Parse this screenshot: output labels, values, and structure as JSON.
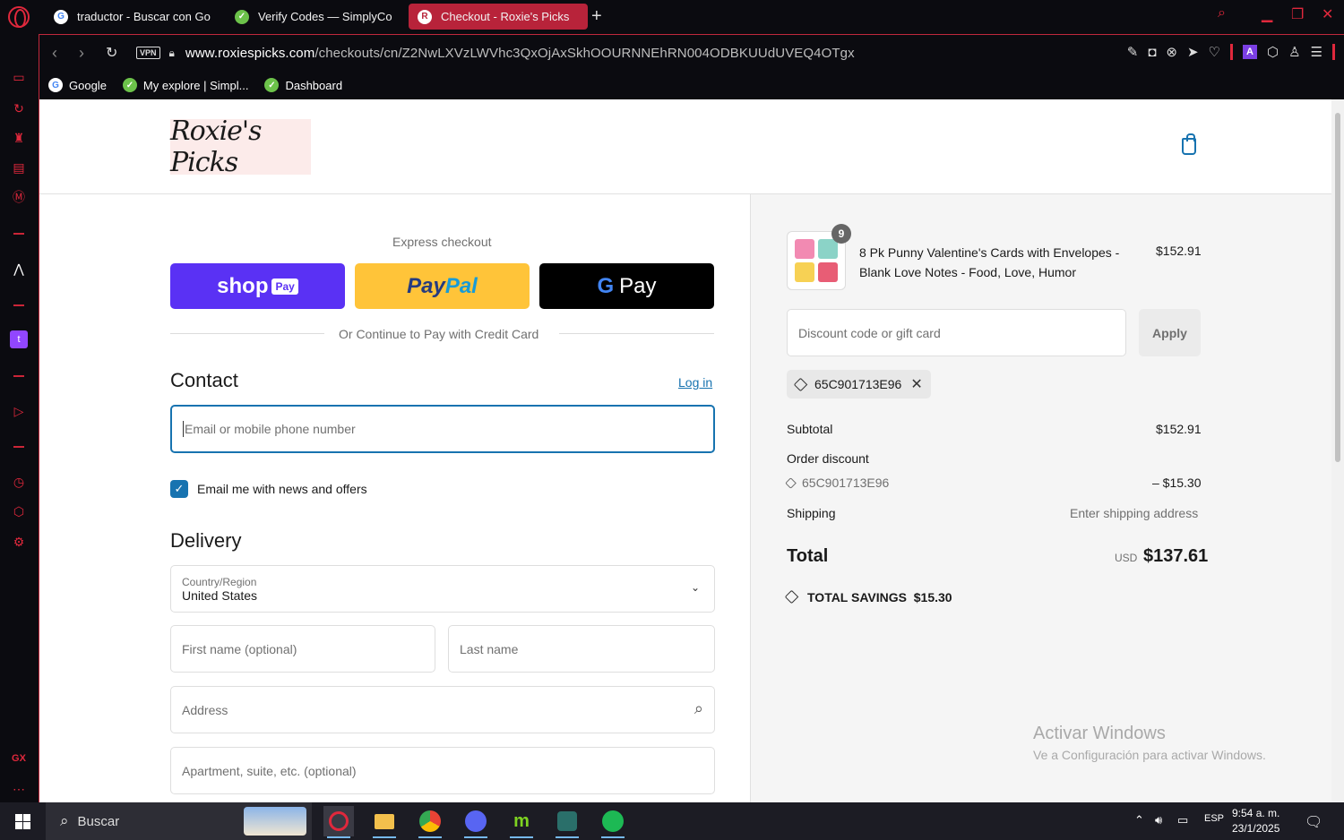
{
  "browser": {
    "tabs": [
      {
        "title": "traductor - Buscar con Go",
        "favicon": "G"
      },
      {
        "title": "Verify Codes — SimplyCo",
        "favicon": "✓"
      },
      {
        "title": "Checkout - Roxie's Picks",
        "favicon": "R"
      }
    ],
    "vpn_label": "VPN",
    "url_domain": "www.roxiespicks.com",
    "url_path": "/checkouts/cn/Z2NwLXVzLWVhc3QxOjAxSkhOOURNNEhRN004ODBKUUdUVEQ4OTgx",
    "bookmarks": [
      {
        "label": "Google",
        "favicon": "G"
      },
      {
        "label": "My explore | Simpl...",
        "favicon": "✓"
      },
      {
        "label": "Dashboard",
        "favicon": "✓"
      }
    ]
  },
  "store": {
    "logo_text": "Roxie's Picks"
  },
  "checkout": {
    "express_label": "Express checkout",
    "shop_pay": {
      "label": "shop",
      "badge": "Pay"
    },
    "paypal": {
      "part1": "Pay",
      "part2": "Pal"
    },
    "gpay": {
      "g": "G",
      "label": "Pay"
    },
    "or_continue": "Or Continue to Pay with Credit Card",
    "contact": {
      "title": "Contact",
      "login": "Log in",
      "email_placeholder": "Email or mobile phone number",
      "news_label": "Email me with news and offers",
      "news_checked": true
    },
    "delivery": {
      "title": "Delivery",
      "country_label": "Country/Region",
      "country_value": "United States",
      "first_name_placeholder": "First name (optional)",
      "last_name_placeholder": "Last name",
      "address_placeholder": "Address",
      "apartment_placeholder": "Apartment, suite, etc. (optional)"
    }
  },
  "summary": {
    "item": {
      "qty": "9",
      "title_line1": "8 Pk Punny Valentine's Cards with Envelopes -",
      "title_line2": "Blank Love Notes - Food, Love, Humor",
      "price": "$152.91"
    },
    "discount_placeholder": "Discount code or gift card",
    "apply_label": "Apply",
    "applied_code": "65C901713E96",
    "subtotal_label": "Subtotal",
    "subtotal_value": "$152.91",
    "order_discount_label": "Order discount",
    "discount_code": "65C901713E96",
    "discount_value": "– $15.30",
    "shipping_label": "Shipping",
    "shipping_value": "Enter shipping address",
    "total_label": "Total",
    "currency": "USD",
    "total_value": "$137.61",
    "savings_label": "TOTAL SAVINGS",
    "savings_value": "$15.30"
  },
  "watermark": {
    "line1": "Activar Windows",
    "line2": "Ve a Configuración para activar Windows."
  },
  "taskbar": {
    "search_label": "Buscar",
    "lang": "ESP",
    "time": "9:54 a. m.",
    "date": "23/1/2025"
  },
  "colors": {
    "accent": "#1773b0",
    "opera_red": "#e0283c",
    "active_tab": "#b8233a",
    "shop_pay": "#5a31f4",
    "paypal": "#ffc439"
  }
}
